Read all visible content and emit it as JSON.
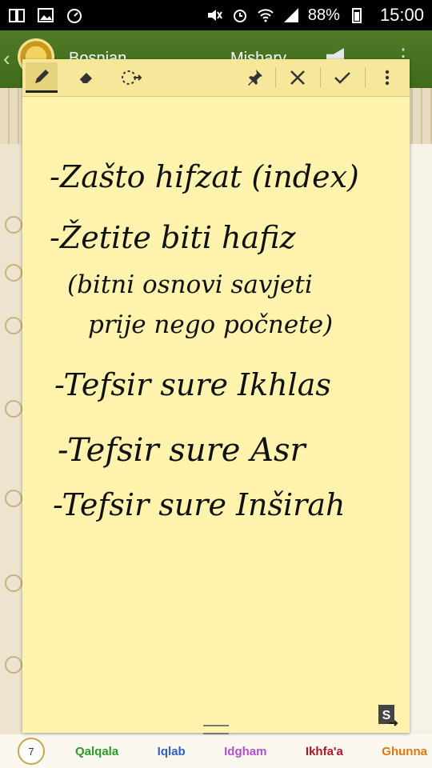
{
  "status_bar": {
    "battery": "88%",
    "time": "15:00",
    "icons": [
      "book-icon",
      "gallery-icon",
      "timer-icon",
      "mute-icon",
      "alarm-icon",
      "wifi-icon",
      "signal-icon",
      "battery-icon"
    ]
  },
  "app_header": {
    "title_left": "Bosnian",
    "title_right": "Mishary"
  },
  "note": {
    "toolbar": [
      "pen-icon",
      "eraser-icon",
      "lasso-icon",
      "pin-icon",
      "close-icon",
      "check-icon",
      "more-icon"
    ],
    "lines": [
      "-Zašto hifzat (index)",
      "-Žetite biti hafiz",
      "(bitni osnovi savjeti",
      "prije nego počnete)",
      "-Tefsir sure Ikhlas",
      "-Tefsir sure Asr",
      "-Tefsir sure Inširah"
    ]
  },
  "legend": {
    "page_number": "7",
    "items": [
      {
        "label": "Qalqala",
        "color": "#2e9a2a"
      },
      {
        "label": "Iqlab",
        "color": "#2f5fc9"
      },
      {
        "label": "Idgham",
        "color": "#b04fd0"
      },
      {
        "label": "Ikhfa'a",
        "color": "#b3122d"
      },
      {
        "label": "Ghunna",
        "color": "#e07a10"
      }
    ]
  }
}
